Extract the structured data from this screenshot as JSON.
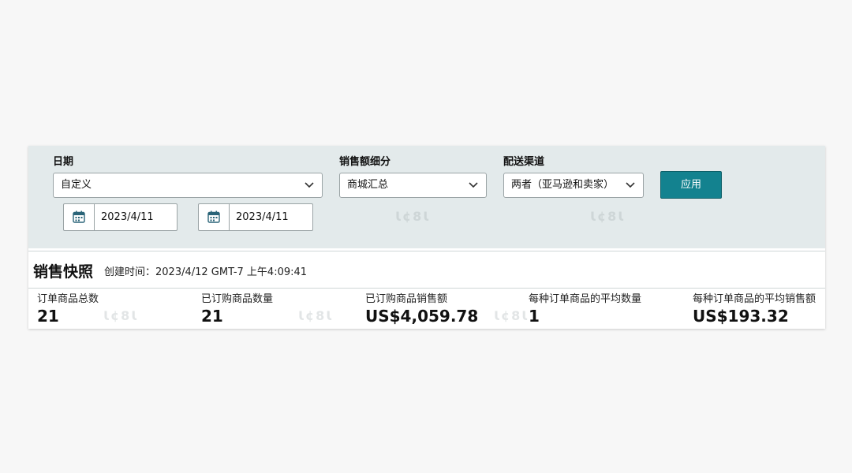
{
  "filters": {
    "date": {
      "label": "日期",
      "selected": "自定义"
    },
    "start_date": "2023/4/11",
    "end_date": "2023/4/11",
    "sales_breakdown": {
      "label": "销售额细分",
      "selected": "商城汇总"
    },
    "channel": {
      "label": "配送渠道",
      "selected": "两者（亚马逊和卖家）"
    },
    "apply_label": "应用"
  },
  "snapshot": {
    "title": "销售快照",
    "created_time": "创建时间：2023/4/12 GMT-7 上午4:09:41",
    "metrics": [
      {
        "label": "订单商品总数",
        "value": "21"
      },
      {
        "label": "已订购商品数量",
        "value": "21"
      },
      {
        "label": "已订购商品销售额",
        "value": "US$4,059.78"
      },
      {
        "label": "每种订单商品的平均数量",
        "value": "1"
      },
      {
        "label": "每种订单商品的平均销售额",
        "value": "US$193.32"
      }
    ]
  },
  "icons": {
    "calendar": "calendar-icon",
    "chevron": "chevron-down-icon"
  },
  "colors": {
    "filter_bg": "#e3eaeb",
    "apply_button": "#13828f",
    "calendar_icon": "#2a6478"
  }
}
